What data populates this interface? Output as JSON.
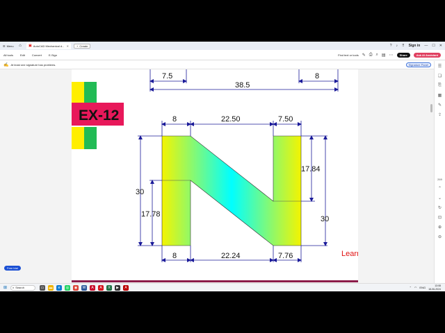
{
  "browser": {
    "menu_label": "Menu",
    "tab_title": "AutoCAD Mechanical d...",
    "new_tab_label": "Create",
    "sign_in": "Sign in"
  },
  "toolbar": {
    "items": [
      "All tools",
      "Edit",
      "Convert",
      "E-Sign"
    ],
    "find_label": "Find text or tools",
    "share_label": "Share",
    "ask_ai_label": "Ask AI Assistant"
  },
  "notification": {
    "message": "At least one signature has problems.",
    "signature_panel_label": "Signature Panel"
  },
  "sidebar": {
    "zoom": "269"
  },
  "free_trial_label": "Free trial",
  "drawing": {
    "exercise_label": "EX-12",
    "watermark": "Learn Engineering Tutorials",
    "top_dims": {
      "left": "7.5",
      "right": "8",
      "total": "38.5"
    },
    "upper_dims": {
      "left": "8",
      "middle": "22.50",
      "right": "7.50"
    },
    "lower_dims": {
      "left": "8",
      "middle": "22.24",
      "right": "7.76"
    },
    "side_dims": {
      "left_total": "30",
      "left_lower": "17.78",
      "right_upper": "17.84",
      "right_total": "30"
    },
    "colors": {
      "label_bg": "#e8185a",
      "yellow": "#ffee00",
      "green": "#22bb55",
      "dim": "#1a1a99",
      "watermark": "#e01010"
    }
  },
  "taskbar": {
    "search_label": "Search",
    "language": "ENG",
    "time": "13:08",
    "date": "18-06-2024"
  }
}
